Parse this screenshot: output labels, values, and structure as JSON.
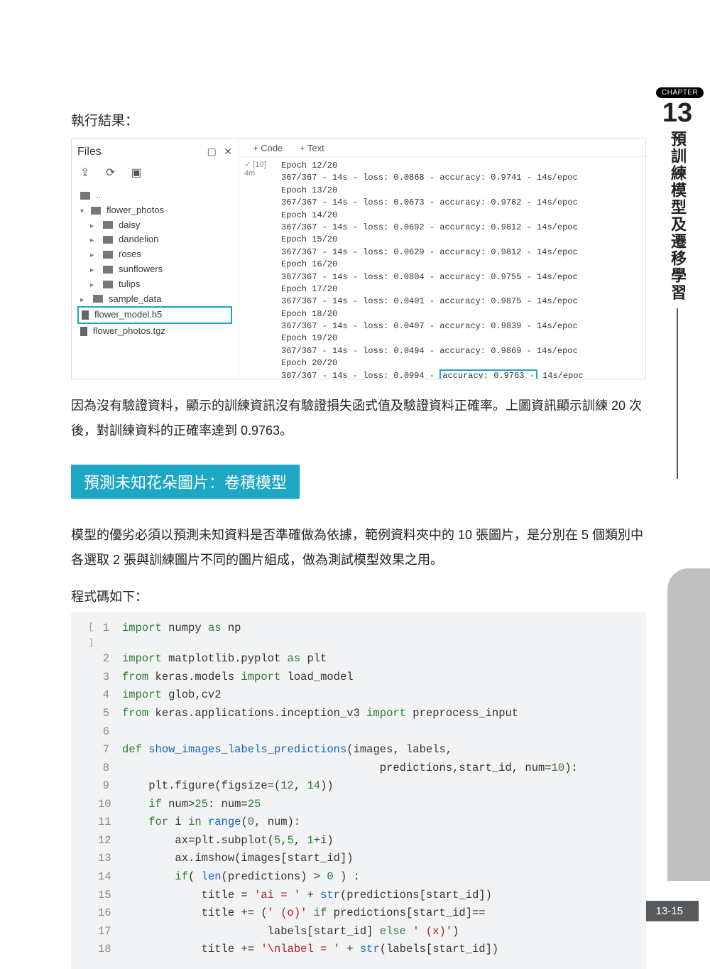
{
  "chapter": {
    "badge": "CHAPTER",
    "num": "13",
    "title": "預訓練模型及遷移學習"
  },
  "page_number": "13-15",
  "run_label": "執行結果：",
  "colab": {
    "files_label": "Files",
    "toolbar": {
      "code": "+ Code",
      "text": "+ Text"
    },
    "cell_id": "[10]",
    "cell_time": "4m",
    "tree": {
      "up": "..",
      "root": "flower_photos",
      "children": [
        "daisy",
        "dandelion",
        "roses",
        "sunflowers",
        "tulips"
      ],
      "siblings": [
        "sample_data"
      ],
      "files": [
        "flower_model.h5",
        "flower_photos.tgz"
      ]
    },
    "epochs": [
      "Epoch 12/20",
      "367/367 - 14s - loss: 0.0868 - accuracy: 0.9741 - 14s/epoc",
      "Epoch 13/20",
      "367/367 - 14s - loss: 0.0673 - accuracy: 0.9782 - 14s/epoc",
      "Epoch 14/20",
      "367/367 - 14s - loss: 0.0692 - accuracy: 0.9812 - 14s/epoc",
      "Epoch 15/20",
      "367/367 - 14s - loss: 0.0629 - accuracy: 0.9812 - 14s/epoc",
      "Epoch 16/20",
      "367/367 - 14s - loss: 0.0804 - accuracy: 0.9755 - 14s/epoc",
      "Epoch 17/20",
      "367/367 - 14s - loss: 0.0401 - accuracy: 0.9875 - 14s/epoc",
      "Epoch 18/20",
      "367/367 - 14s - loss: 0.0407 - accuracy: 0.9839 - 14s/epoc",
      "Epoch 19/20",
      "367/367 - 14s - loss: 0.0494 - accuracy: 0.9869 - 14s/epoc",
      "Epoch 20/20"
    ],
    "last_pre": "367/367 - 14s - loss: 0.0994 - ",
    "last_hl": "accuracy: 0.9763 -",
    "last_post": " 14s/epoc"
  },
  "para1": "因為沒有驗證資料，顯示的訓練資訊沒有驗證損失函式值及驗證資料正確率。上圖資訊顯示訓練 20 次後，對訓練資料的正確率達到 0.9763。",
  "section_heading": "預測未知花朵圖片：卷積模型",
  "para2": "模型的優劣必須以預測未知資料是否準確做為依據，範例資料夾中的 10 張圖片，是分別在 5 個類別中各選取 2 張與訓練圖片不同的圖片組成，做為測試模型效果之用。",
  "code_label": "程式碼如下：",
  "cell_marker": "[ ]",
  "code": [
    {
      "n": "1",
      "h": "<span class='kw'>import</span> numpy <span class='kw'>as</span> np"
    },
    {
      "n": "2",
      "h": "<span class='kw'>import</span> matplotlib.pyplot <span class='kw'>as</span> plt"
    },
    {
      "n": "3",
      "h": "<span class='kw'>from</span> keras.models <span class='kw'>import</span> load_model"
    },
    {
      "n": "4",
      "h": "<span class='kw'>import</span> glob,cv2"
    },
    {
      "n": "5",
      "h": "<span class='kw'>from</span> keras.applications.inception_v3 <span class='kw'>import</span> preprocess_input"
    },
    {
      "n": "6",
      "h": ""
    },
    {
      "n": "7",
      "h": "<span class='kw'>def</span> <span class='fn'>show_images_labels_predictions</span>(images, labels,"
    },
    {
      "n": "8",
      "h": "                                       predictions,start_id, num=<span class='num'>10</span>):"
    },
    {
      "n": "9",
      "h": "    plt.figure(figsize=(<span class='num'>12</span>, <span class='num'>14</span>))"
    },
    {
      "n": "10",
      "h": "    <span class='kw'>if</span> num&gt;<span class='num'>25</span>: num=<span class='num'>25</span>"
    },
    {
      "n": "11",
      "h": "    <span class='kw'>for</span> i <span class='kw'>in</span> <span class='fn'>range</span>(<span class='num'>0</span>, num):"
    },
    {
      "n": "12",
      "h": "        ax=plt.subplot(<span class='num'>5</span>,<span class='num'>5</span>, <span class='num'>1</span>+i)"
    },
    {
      "n": "13",
      "h": "        ax.imshow(images[start_id])"
    },
    {
      "n": "14",
      "h": "        <span class='kw'>if</span>( <span class='fn'>len</span>(predictions) &gt; <span class='num'>0</span> ) :"
    },
    {
      "n": "15",
      "h": "            title = <span class='str'>'ai = '</span> + <span class='fn'>str</span>(predictions[start_id])"
    },
    {
      "n": "16",
      "h": "            title += (<span class='str'>' (o)'</span> <span class='kw'>if</span> predictions[start_id]=="
    },
    {
      "n": "17",
      "h": "                      labels[start_id] <span class='kw'>else</span> <span class='str'>' (x)'</span>)"
    },
    {
      "n": "18",
      "h": "            title += <span class='str'>'\\nlabel = '</span> + <span class='fn'>str</span>(labels[start_id])"
    }
  ]
}
